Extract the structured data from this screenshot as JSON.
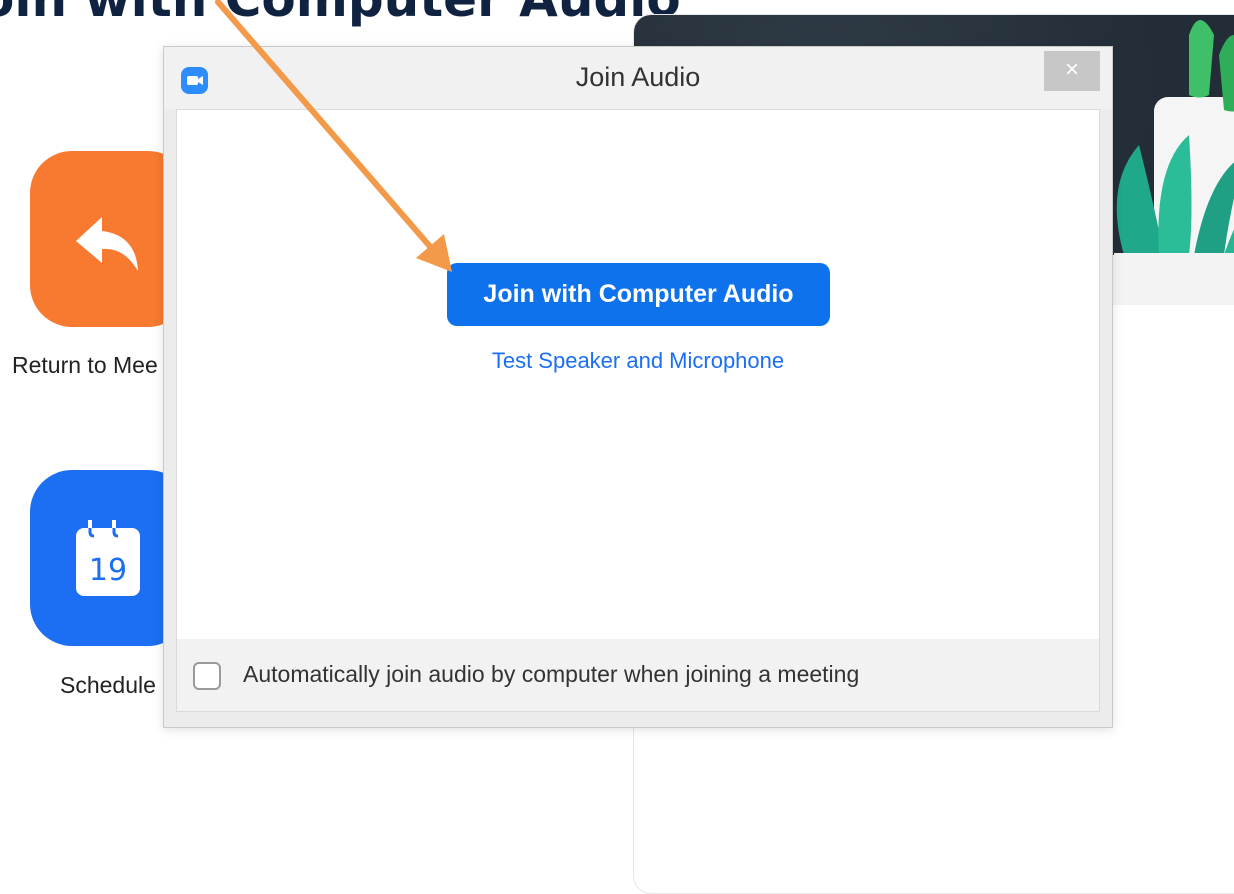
{
  "annotation": {
    "title": "oin with Computer Audio"
  },
  "home": {
    "tiles": [
      {
        "label": "Return to Mee",
        "icon": "reply-arrow-icon",
        "color": "#f77a30"
      },
      {
        "label": "Schedule",
        "icon": "calendar-icon",
        "color": "#1c6ff2",
        "calendar_day": "19"
      }
    ]
  },
  "dialog": {
    "title": "Join Audio",
    "close_label": "×",
    "join_button_label": "Join with Computer Audio",
    "test_link_label": "Test Speaker and Microphone",
    "auto_join_label": "Automatically join audio by computer when joining a meeting",
    "auto_join_checked": false
  },
  "colors": {
    "accent_blue": "#0e72ed",
    "link_blue": "#1c6ff2",
    "annotation_orange": "#f2994a",
    "annotation_text": "#0f2340"
  }
}
